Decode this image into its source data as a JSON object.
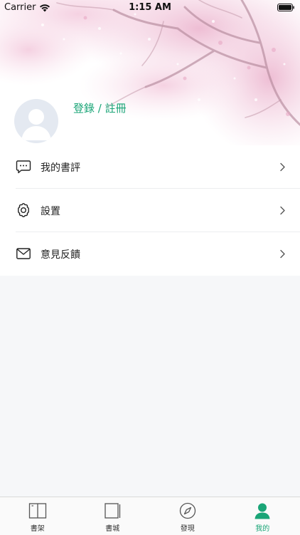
{
  "status_bar": {
    "carrier": "Carrier",
    "time": "1:15 AM"
  },
  "profile": {
    "login_label": "登錄 / 註冊"
  },
  "menu": {
    "items": [
      {
        "label": "我的書評",
        "icon": "comment-icon"
      },
      {
        "label": "設置",
        "icon": "gear-icon"
      },
      {
        "label": "意見反饋",
        "icon": "envelope-icon"
      }
    ]
  },
  "tabbar": {
    "items": [
      {
        "label": "書架",
        "icon": "book-open-icon"
      },
      {
        "label": "書城",
        "icon": "book-icon"
      },
      {
        "label": "發現",
        "icon": "compass-icon"
      },
      {
        "label": "我的",
        "icon": "person-icon"
      }
    ],
    "active": "我的"
  },
  "colors": {
    "accent": "#1aa577",
    "background": "#f6f7f9",
    "blossom": "#f1c6dc"
  }
}
